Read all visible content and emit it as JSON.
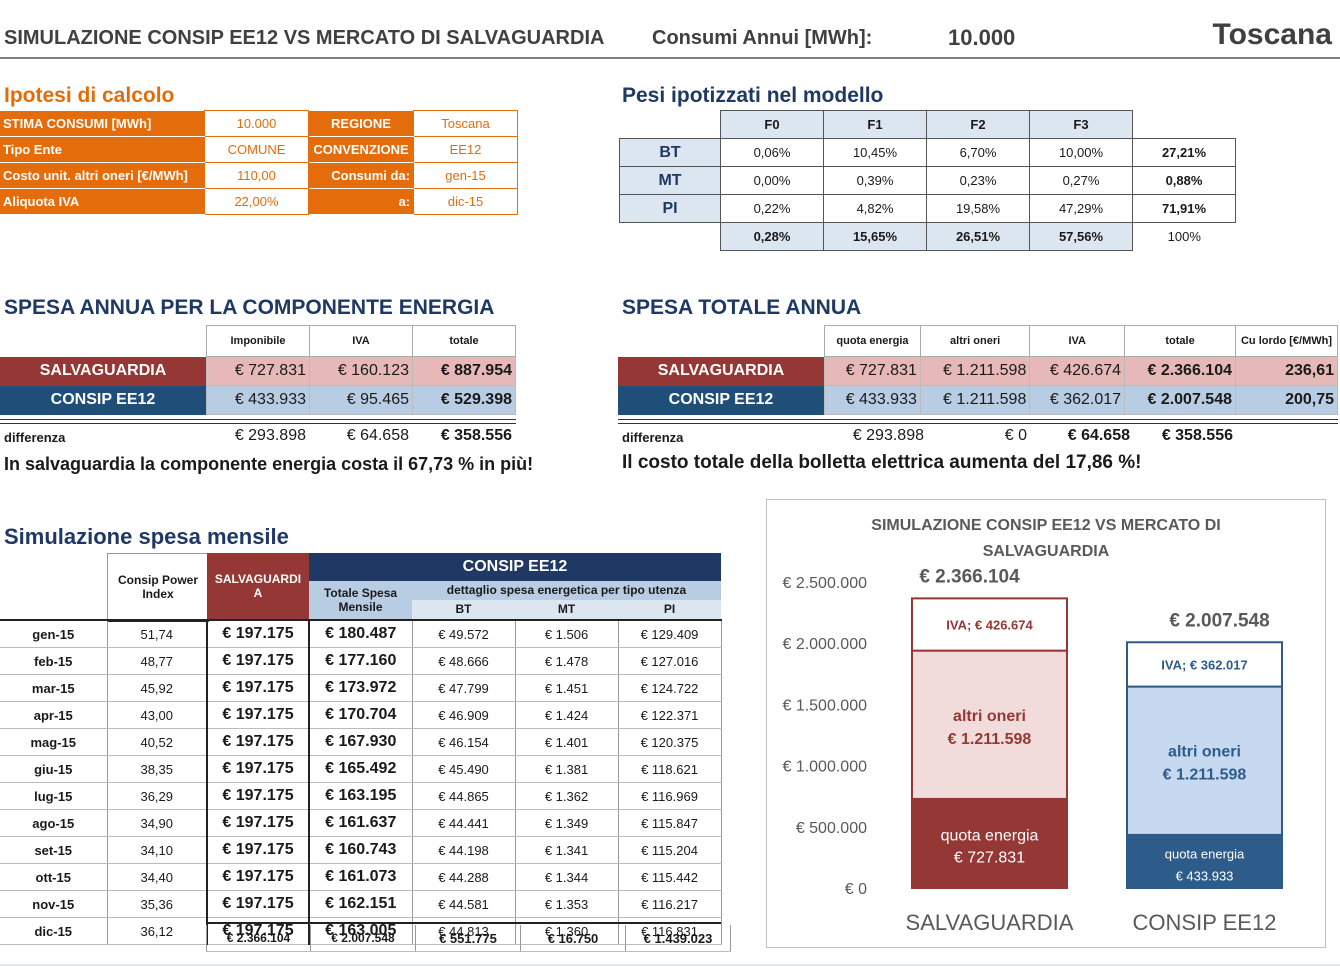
{
  "header": {
    "title": "SIMULAZIONE CONSIP EE12 VS MERCATO DI SALVAGUARDIA",
    "consumi_label": "Consumi Annui [MWh]:",
    "consumi_value": "10.000",
    "regione": "Toscana"
  },
  "ipotesi": {
    "title": "Ipotesi di calcolo",
    "rows": [
      {
        "label": "STIMA CONSUMI [MWh]",
        "value": "10.000",
        "label2": "REGIONE",
        "value2": "Toscana"
      },
      {
        "label": "Tipo Ente",
        "value": "COMUNE",
        "label2": "CONVENZIONE",
        "value2": "EE12"
      },
      {
        "label": "Costo unit. altri oneri [€/MWh]",
        "value": "110,00",
        "label2": "Consumi da:",
        "value2": "gen-15"
      },
      {
        "label": "Aliquota IVA",
        "value": "22,00%",
        "label2": "a:",
        "value2": "dic-15"
      }
    ]
  },
  "pesi": {
    "title": "Pesi ipotizzati nel modello",
    "headers": [
      "F0",
      "F1",
      "F2",
      "F3"
    ],
    "rows": [
      {
        "label": "BT",
        "values": [
          "0,06%",
          "10,45%",
          "6,70%",
          "10,00%"
        ],
        "total": "27,21%"
      },
      {
        "label": "MT",
        "values": [
          "0,00%",
          "0,39%",
          "0,23%",
          "0,27%"
        ],
        "total": "0,88%"
      },
      {
        "label": "PI",
        "values": [
          "0,22%",
          "4,82%",
          "19,58%",
          "47,29%"
        ],
        "total": "71,91%"
      }
    ],
    "totals": [
      "0,28%",
      "15,65%",
      "26,51%",
      "57,56%"
    ],
    "grand_total": "100%"
  },
  "energia": {
    "title": "SPESA  ANNUA PER LA COMPONENTE ENERGIA",
    "headers": [
      "Imponibile",
      "IVA",
      "totale"
    ],
    "salv_label": "SALVAGUARDIA",
    "salv": [
      "€ 727.831",
      "€ 160.123",
      "€ 887.954"
    ],
    "consip_label": "CONSIP EE12",
    "consip": [
      "€ 433.933",
      "€ 95.465",
      "€ 529.398"
    ],
    "diff_label": "differenza",
    "diff": [
      "€ 293.898",
      "€ 64.658",
      "€ 358.556"
    ],
    "note": "In salvaguardia la componente energia costa il 67,73 % in più!"
  },
  "totale": {
    "title": "SPESA TOTALE ANNUA",
    "headers": [
      "quota energia",
      "altri oneri",
      "IVA",
      "totale",
      "Cu lordo [€/MWh]"
    ],
    "salv_label": "SALVAGUARDIA",
    "salv": [
      "€ 727.831",
      "€ 1.211.598",
      "€ 426.674",
      "€ 2.366.104",
      "236,61"
    ],
    "consip_label": "CONSIP EE12",
    "consip": [
      "€ 433.933",
      "€ 1.211.598",
      "€ 362.017",
      "€ 2.007.548",
      "200,75"
    ],
    "diff_label": "differenza",
    "diff": [
      "€ 293.898",
      "€ 0",
      "€ 64.658",
      "€ 358.556"
    ],
    "note": "Il costo totale della bolletta elettrica aumenta del 17,86 %!"
  },
  "mensile": {
    "title": "Simulazione spesa mensile",
    "h_index": "Consip Power Index",
    "h_salv": "SALVAGUARDIA",
    "h_consip": "CONSIP EE12",
    "h_totale": "Totale Spesa Mensile",
    "h_dettaglio": "dettaglio spesa energetica per tipo utenza",
    "h_bt": "BT",
    "h_mt": "MT",
    "h_pi": "PI",
    "rows": [
      [
        "gen-15",
        "51,74",
        "€ 197.175",
        "€ 180.487",
        "€ 49.572",
        "€ 1.506",
        "€ 129.409"
      ],
      [
        "feb-15",
        "48,77",
        "€ 197.175",
        "€ 177.160",
        "€ 48.666",
        "€ 1.478",
        "€ 127.016"
      ],
      [
        "mar-15",
        "45,92",
        "€ 197.175",
        "€ 173.972",
        "€ 47.799",
        "€ 1.451",
        "€ 124.722"
      ],
      [
        "apr-15",
        "43,00",
        "€ 197.175",
        "€ 170.704",
        "€ 46.909",
        "€ 1.424",
        "€ 122.371"
      ],
      [
        "mag-15",
        "40,52",
        "€ 197.175",
        "€ 167.930",
        "€ 46.154",
        "€ 1.401",
        "€ 120.375"
      ],
      [
        "giu-15",
        "38,35",
        "€ 197.175",
        "€ 165.492",
        "€ 45.490",
        "€ 1.381",
        "€ 118.621"
      ],
      [
        "lug-15",
        "36,29",
        "€ 197.175",
        "€ 163.195",
        "€ 44.865",
        "€ 1.362",
        "€ 116.969"
      ],
      [
        "ago-15",
        "34,90",
        "€ 197.175",
        "€ 161.637",
        "€ 44.441",
        "€ 1.349",
        "€ 115.847"
      ],
      [
        "set-15",
        "34,10",
        "€ 197.175",
        "€ 160.743",
        "€ 44.198",
        "€ 1.341",
        "€ 115.204"
      ],
      [
        "ott-15",
        "34,40",
        "€ 197.175",
        "€ 161.073",
        "€ 44.288",
        "€ 1.344",
        "€ 115.442"
      ],
      [
        "nov-15",
        "35,36",
        "€ 197.175",
        "€ 162.151",
        "€ 44.581",
        "€ 1.353",
        "€ 116.217"
      ],
      [
        "dic-15",
        "36,12",
        "€ 197.175",
        "€ 163.005",
        "€ 44.813",
        "€ 1.360",
        "€ 116.831"
      ]
    ],
    "totals": [
      "€ 2.366.104",
      "€ 2.007.548",
      "€ 551.775",
      "€ 16.750",
      "€ 1.439.023"
    ]
  },
  "chart_data": {
    "type": "bar",
    "stacked": true,
    "title": "SIMULAZIONE CONSIP EE12 VS MERCATO DI SALVAGUARDIA",
    "categories": [
      "SALVAGUARDIA",
      "CONSIP EE12"
    ],
    "series": [
      {
        "name": "quota energia",
        "values": [
          727831,
          433933
        ],
        "labels": [
          "quota energia",
          "quota energia"
        ],
        "value_labels": [
          "€ 727.831",
          "€ 433.933"
        ]
      },
      {
        "name": "altri oneri",
        "values": [
          1211598,
          1211598
        ],
        "labels": [
          "altri oneri",
          "altri oneri"
        ],
        "value_labels": [
          "€ 1.211.598",
          "€ 1.211.598"
        ]
      },
      {
        "name": "IVA",
        "values": [
          426674,
          362017
        ],
        "labels": [
          "IVA; € 426.674",
          "IVA; € 362.017"
        ]
      }
    ],
    "totals": [
      2366104,
      2007548
    ],
    "total_labels": [
      "€ 2.366.104",
      "€ 2.007.548"
    ],
    "ylim": [
      0,
      2500000
    ],
    "yticks": [
      "€ 0",
      "€ 500.000",
      "€ 1.000.000",
      "€ 1.500.000",
      "€ 2.000.000",
      "€ 2.500.000"
    ],
    "grid": false,
    "colors": {
      "salv_energia": "#953735",
      "salv_oneri": "#f2dcdb",
      "salv_iva": "#ffffff",
      "salv_border": "#953735",
      "consip_energia": "#2e5c8a",
      "consip_oneri": "#c6d9f1",
      "consip_iva": "#ffffff",
      "consip_border": "#2e5c8a"
    }
  }
}
